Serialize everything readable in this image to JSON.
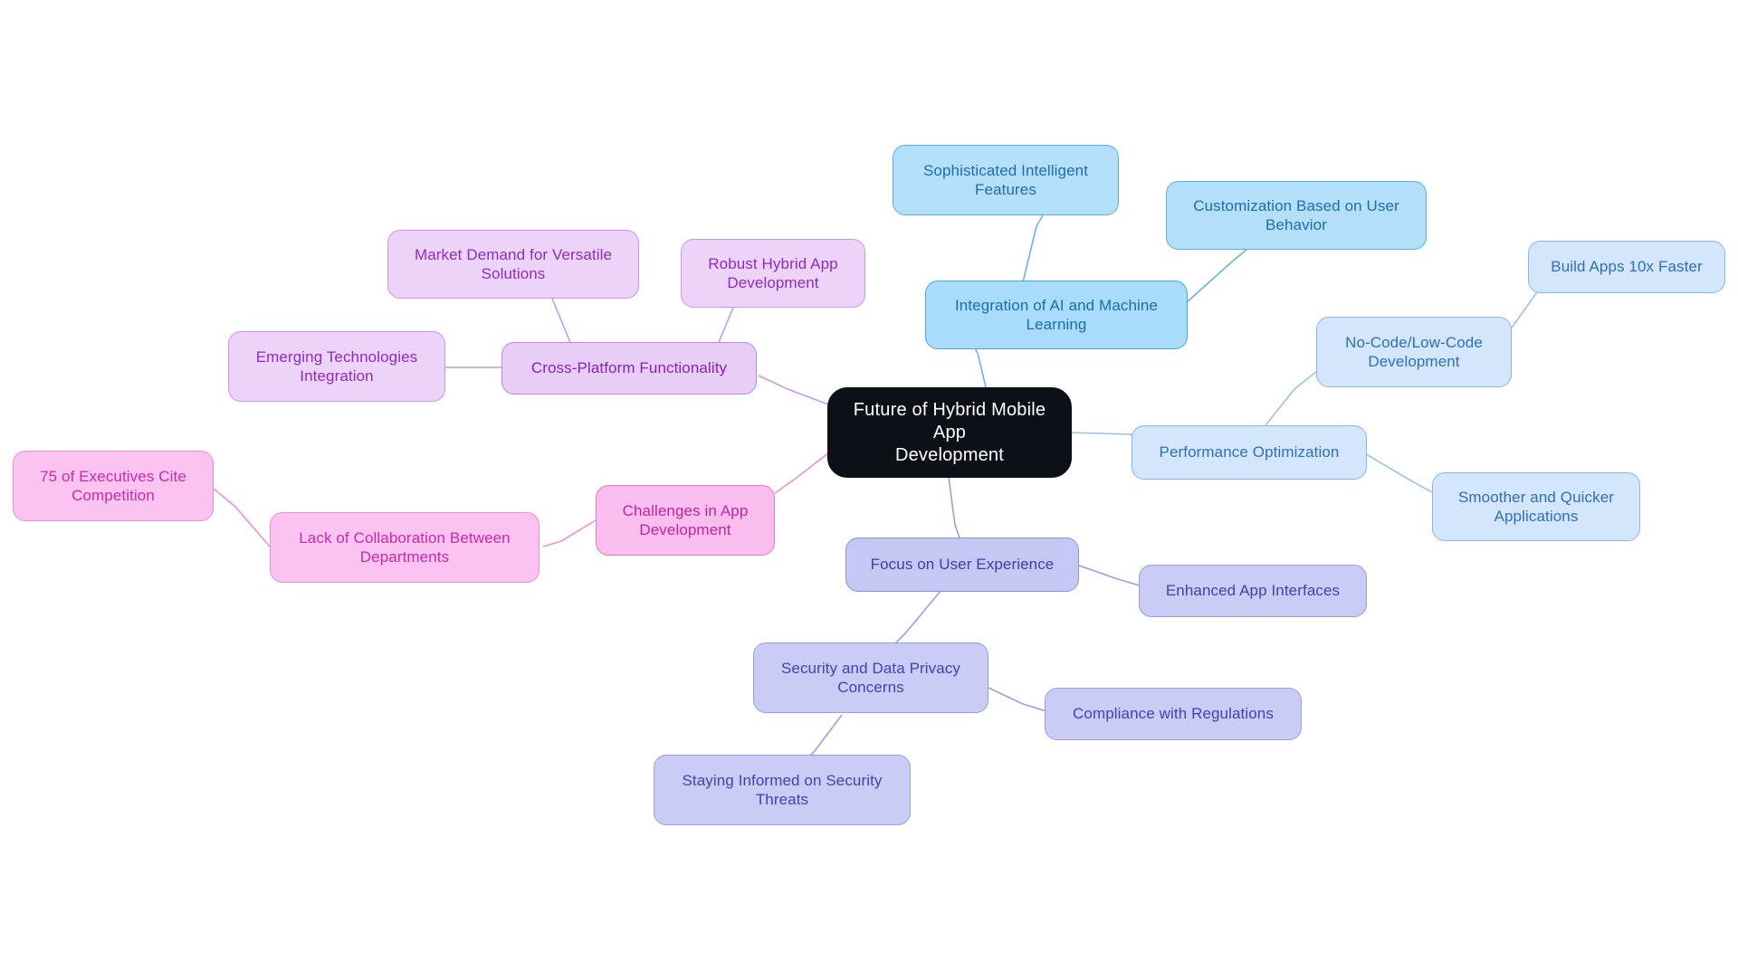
{
  "diagram": {
    "type": "mindmap",
    "title": "Future of Hybrid Mobile App Development",
    "background": "#ffffff",
    "root": {
      "id": "root",
      "label": "Future of Hybrid Mobile App\nDevelopment",
      "fill": "#0d1117",
      "text_color": "#ffffff"
    },
    "branches": [
      {
        "id": "ai-ml",
        "label": "Integration of AI and Machine\nLearning",
        "fill": "#a8dcfa",
        "border": "#4aa8dd",
        "text_color": "#1a6ea8",
        "children": [
          {
            "id": "sophisticated-features",
            "label": "Sophisticated Intelligent\nFeatures",
            "fill": "#b3dffb",
            "text_color": "#1d6fa5"
          },
          {
            "id": "customization-behavior",
            "label": "Customization Based on User\nBehavior",
            "fill": "#b3dffb",
            "text_color": "#1d6fa5"
          }
        ]
      },
      {
        "id": "performance",
        "label": "Performance Optimization",
        "fill": "#d3e6fb",
        "border": "#8ab6e2",
        "text_color": "#2f6fb5",
        "children": [
          {
            "id": "no-code-low-code",
            "label": "No-Code/Low-Code\nDevelopment",
            "fill": "#d3e6fb",
            "text_color": "#2f6fb5",
            "children": [
              {
                "id": "build-10x-faster",
                "label": "Build Apps 10x Faster",
                "fill": "#d3e6fb",
                "text_color": "#2f6fb5"
              }
            ]
          },
          {
            "id": "smoother-quicker",
            "label": "Smoother and Quicker\nApplications",
            "fill": "#d3e6fb",
            "text_color": "#2f6fb5"
          }
        ]
      },
      {
        "id": "user-experience",
        "label": "Focus on User Experience",
        "fill": "#c5c8f2",
        "border": "#8e92d8",
        "text_color": "#3b3fa8",
        "children": [
          {
            "id": "enhanced-interfaces",
            "label": "Enhanced App Interfaces",
            "fill": "#c9ccf5",
            "text_color": "#3f43b0"
          },
          {
            "id": "security-privacy",
            "label": "Security and Data Privacy\nConcerns",
            "fill": "#c9ccf5",
            "text_color": "#3f43b0",
            "children": [
              {
                "id": "compliance-regulations",
                "label": "Compliance with Regulations",
                "fill": "#c9ccf5",
                "text_color": "#3f43b0"
              },
              {
                "id": "staying-informed",
                "label": "Staying Informed on Security\nThreats",
                "fill": "#c9ccf5",
                "text_color": "#3f43b0"
              }
            ]
          }
        ]
      },
      {
        "id": "challenges",
        "label": "Challenges in App\nDevelopment",
        "fill": "#f9bdee",
        "border": "#e479cd",
        "text_color": "#c0249e",
        "children": [
          {
            "id": "lack-collaboration",
            "label": "Lack of Collaboration Between\nDepartments",
            "fill": "#fbc3f0",
            "text_color": "#c92aa6",
            "children": [
              {
                "id": "executives-competition",
                "label": "75 of Executives Cite\nCompetition",
                "fill": "#fbc3f0",
                "text_color": "#c92aa6"
              }
            ]
          }
        ]
      },
      {
        "id": "cross-platform",
        "label": "Cross-Platform Functionality",
        "fill": "#e8cdf7",
        "border": "#bf8ae0",
        "text_color": "#8324b8",
        "children": [
          {
            "id": "market-demand",
            "label": "Market Demand for Versatile\nSolutions",
            "fill": "#eed3f9",
            "text_color": "#8b2cc0"
          },
          {
            "id": "robust-hybrid",
            "label": "Robust Hybrid App\nDevelopment",
            "fill": "#eed3f9",
            "text_color": "#8b2cc0"
          },
          {
            "id": "emerging-tech",
            "label": "Emerging Technologies\nIntegration",
            "fill": "#eed3f9",
            "text_color": "#8b2cc0"
          }
        ]
      }
    ],
    "edge_colors": {
      "blue": "#6ab4e0",
      "blue_pale": "#9cc2e6",
      "periwinkle": "#9a9ee0",
      "pink": "#e98fd6",
      "violet": "#c89ae4"
    }
  }
}
